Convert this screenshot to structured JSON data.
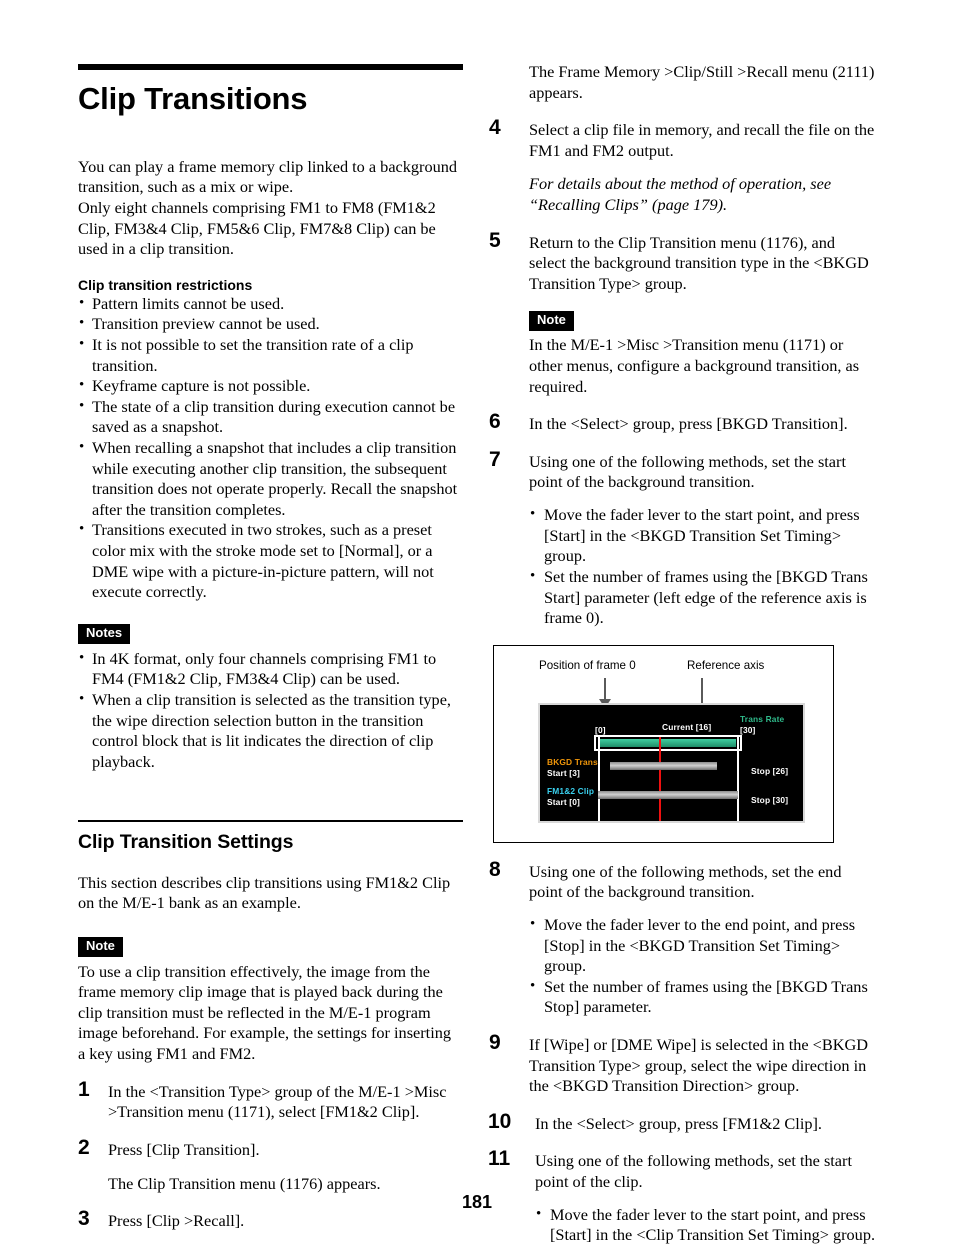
{
  "page": {
    "number": "181",
    "chapter_title": "Clip Transitions"
  },
  "left_column": {
    "intro": "You can play a frame memory clip linked to a background transition, such as a mix or wipe.\nOnly eight channels comprising FM1 to FM8 (FM1&2 Clip, FM3&4 Clip, FM5&6 Clip, FM7&8 Clip) can be used in a clip transition.",
    "restrictions_heading": "Clip transition restrictions",
    "restrictions": [
      "Pattern limits cannot be used.",
      "Transition preview cannot be used.",
      "It is not possible to set the transition rate of a clip transition.",
      "Keyframe capture is not possible.",
      "The state of a clip transition during execution cannot be saved as a snapshot.",
      "When recalling a snapshot that includes a clip transition while executing another clip transition, the subsequent transition does not operate properly. Recall the snapshot after the transition completes.",
      "Transitions executed in two strokes, such as a preset color mix with the stroke mode set to [Normal], or a DME wipe with a picture-in-picture pattern, will not execute correctly."
    ],
    "notes_badge": "Notes",
    "notes": [
      "In 4K format, only four channels comprising FM1 to FM4 (FM1&2 Clip, FM3&4 Clip) can be used.",
      "When a clip transition is selected as the transition type, the wipe direction selection button in the transition control block that is lit indicates the direction of clip playback."
    ],
    "section_title": "Clip Transition Settings",
    "section_intro": "This section describes clip transitions using FM1&2 Clip on the M/E-1 bank as an example.",
    "note_badge": "Note",
    "note_body": "To use a clip transition effectively, the image from the frame memory clip image that is played back during the clip transition must be reflected in the M/E-1 program image beforehand. For example, the settings for inserting a key using FM1 and FM2.",
    "steps": [
      {
        "num": "1",
        "body": "In the <Transition Type> group of the M/E-1 >Misc >Transition menu (1171), select [FM1&2 Clip]."
      },
      {
        "num": "2",
        "body": "Press [Clip Transition].",
        "follow": "The Clip Transition menu (1176) appears."
      },
      {
        "num": "3",
        "body": "Press [Clip >Recall]."
      }
    ]
  },
  "right_column": {
    "lead_paragraph": "The Frame Memory >Clip/Still >Recall menu (2111) appears.",
    "steps": [
      {
        "num": "4",
        "body": "Select a clip file in memory, and recall the file on the FM1 and FM2 output.",
        "follow_italic": "For details about the method of operation, see “Recalling Clips” (page 179)."
      },
      {
        "num": "5",
        "body": "Return to the Clip Transition menu (1176), and select the background transition type in the <BKGD Transition Type> group.",
        "note_badge": "Note",
        "note_body": "In the M/E-1 >Misc >Transition menu (1171) or other menus, configure a background transition, as required."
      },
      {
        "num": "6",
        "body": "In the <Select> group, press [BKGD Transition]."
      },
      {
        "num": "7",
        "body": "Using one of the following methods, set the start point of the background transition.",
        "bullets": [
          "Move the fader lever to the start point, and press [Start] in the <BKGD Transition Set Timing> group.",
          "Set the number of frames using the [BKGD Trans Start] parameter (left edge of the reference axis is frame 0)."
        ]
      },
      {
        "num": "8",
        "body": "Using one of the following methods, set the end point of the background transition.",
        "bullets": [
          "Move the fader lever to the end point, and press [Stop] in the <BKGD Transition Set Timing> group.",
          "Set the number of frames using the [BKGD Trans Stop] parameter."
        ]
      },
      {
        "num": "9",
        "body": "If [Wipe] or [DME Wipe] is selected in the <BKGD Transition Type> group, select the wipe direction in the <BKGD Transition Direction> group."
      },
      {
        "num": "10",
        "body": "In the <Select> group, press [FM1&2 Clip]."
      },
      {
        "num": "11",
        "body": "Using one of the following methods, set the start point of the clip.",
        "bullets": [
          "Move the fader lever to the start point, and press [Start] in the <Clip Transition Set Timing> group."
        ]
      }
    ],
    "figure": {
      "callout_frame0": "Position of frame 0",
      "callout_reference_axis": "Reference axis",
      "panel": {
        "frame0_marker": "[0]",
        "current_label": "Current [16]",
        "trans_rate_label": "Trans Rate",
        "trans_rate_value": "[30]",
        "bkgd_trans_label": "BKGD Trans",
        "bkgd_trans_start": "Start [3]",
        "bkgd_trans_stop": "Stop [26]",
        "clip_label": "FM1&2 Clip",
        "clip_start": "Start [0]",
        "clip_stop": "Stop [30]",
        "colors": {
          "background": "#000000",
          "rate_bar": "#2fb98a",
          "current_marker": "#ef1010",
          "bkgd_label": "#f0960a",
          "clip_label": "#3ad0ee",
          "axis": "#ffffff"
        }
      }
    }
  }
}
